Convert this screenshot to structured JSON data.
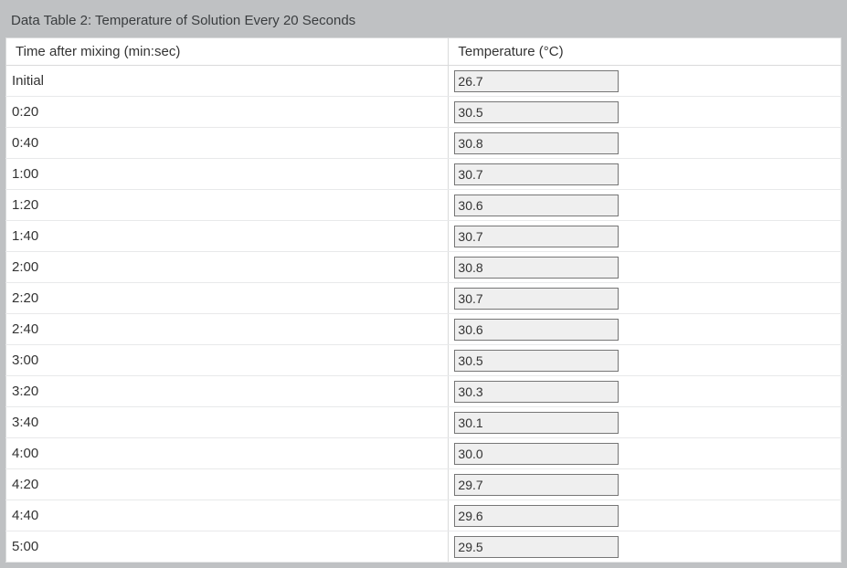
{
  "title": "Data Table 2: Temperature of Solution Every 20 Seconds",
  "headers": {
    "time": "Time after mixing (min:sec)",
    "temp": "Temperature (°C)"
  },
  "rows": [
    {
      "time": "Initial",
      "temp": "26.7"
    },
    {
      "time": "0:20",
      "temp": "30.5"
    },
    {
      "time": "0:40",
      "temp": "30.8"
    },
    {
      "time": "1:00",
      "temp": "30.7"
    },
    {
      "time": "1:20",
      "temp": "30.6"
    },
    {
      "time": "1:40",
      "temp": "30.7"
    },
    {
      "time": "2:00",
      "temp": "30.8"
    },
    {
      "time": "2:20",
      "temp": "30.7"
    },
    {
      "time": "2:40",
      "temp": "30.6"
    },
    {
      "time": "3:00",
      "temp": "30.5"
    },
    {
      "time": "3:20",
      "temp": "30.3"
    },
    {
      "time": "3:40",
      "temp": "30.1"
    },
    {
      "time": "4:00",
      "temp": "30.0"
    },
    {
      "time": "4:20",
      "temp": "29.7"
    },
    {
      "time": "4:40",
      "temp": "29.6"
    },
    {
      "time": "5:00",
      "temp": "29.5"
    }
  ]
}
